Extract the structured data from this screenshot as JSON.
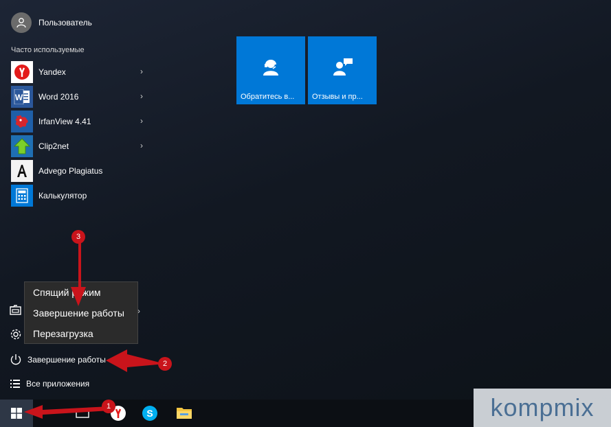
{
  "user": {
    "name": "Пользователь",
    "icon": "user-icon"
  },
  "section_title": "Часто используемые",
  "apps": [
    {
      "label": "Yandex",
      "icon": "yandex-icon",
      "has_submenu": true
    },
    {
      "label": "Word 2016",
      "icon": "word-icon",
      "has_submenu": true
    },
    {
      "label": "IrfanView 4.41",
      "icon": "irfanview-icon",
      "has_submenu": true
    },
    {
      "label": "Clip2net",
      "icon": "clip2net-icon",
      "has_submenu": true
    },
    {
      "label": "Advego Plagiatus",
      "icon": "advego-icon",
      "has_submenu": false
    },
    {
      "label": "Калькулятор",
      "icon": "calculator-icon",
      "has_submenu": false
    }
  ],
  "tiles": [
    {
      "label": "Обратитесь в...",
      "icon": "support-agent-icon"
    },
    {
      "label": "Отзывы и пр...",
      "icon": "feedback-icon"
    }
  ],
  "power_menu": {
    "items": [
      "Спящий режим",
      "Завершение работы",
      "Перезагрузка"
    ]
  },
  "bottom": {
    "power_label": "Завершение работы",
    "all_apps_label": "Все приложения"
  },
  "annotations": [
    "1",
    "2",
    "3"
  ],
  "watermark": "kompmix",
  "colors": {
    "tile": "#0078d7",
    "arrow": "#c9141b",
    "taskbar": "#0c0f14"
  }
}
